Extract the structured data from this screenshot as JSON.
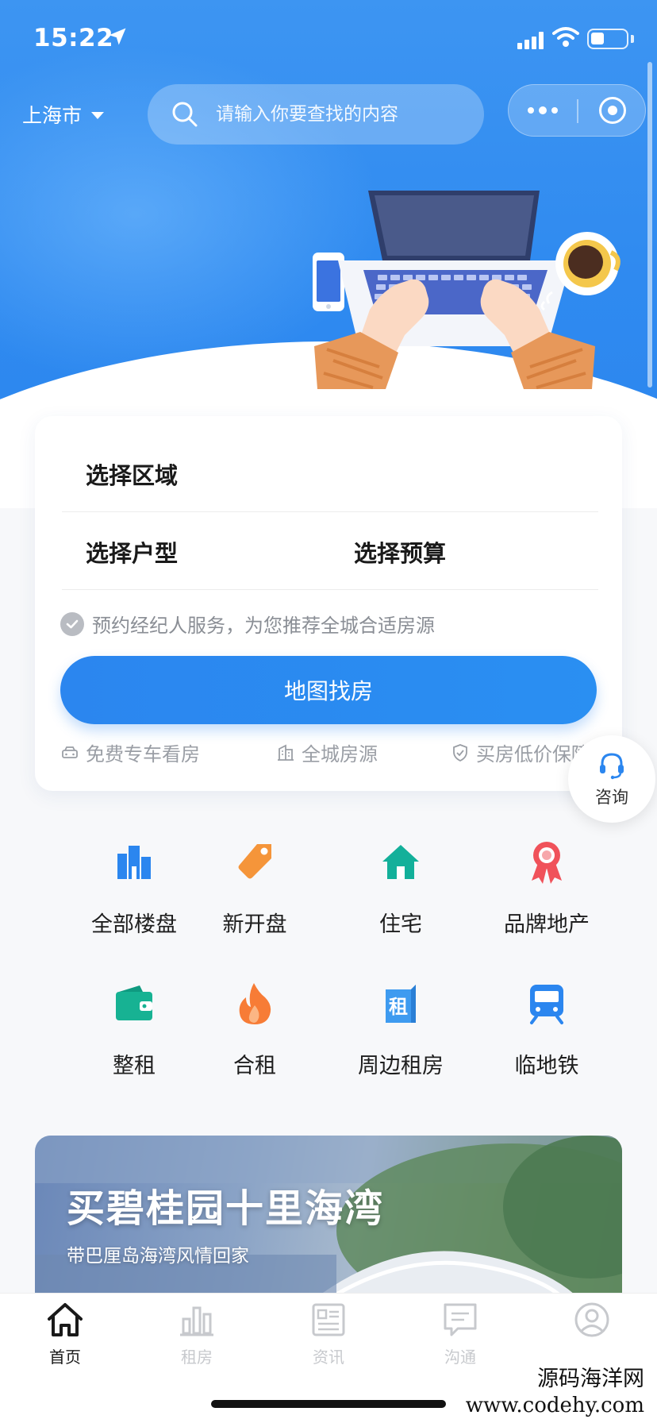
{
  "status_bar": {
    "time": "15:22"
  },
  "header": {
    "city": "上海市",
    "search_placeholder": "请输入你要查找的内容"
  },
  "search_card": {
    "select_region": "选择区域",
    "select_type": "选择户型",
    "select_budget": "选择预算",
    "agent_service": "预约经纪人服务，为您推荐全城合适房源",
    "map_button": "地图找房",
    "features": [
      "免费专车看房",
      "全城房源",
      "买房低价保障"
    ]
  },
  "consult": {
    "label": "咨询"
  },
  "categories": [
    {
      "label": "全部楼盘",
      "icon": "buildings-icon",
      "color": "#2b86ef"
    },
    {
      "label": "新开盘",
      "icon": "tag-icon",
      "color": "#f5953a"
    },
    {
      "label": "住宅",
      "icon": "house-icon",
      "color": "#13b09a"
    },
    {
      "label": "品牌地产",
      "icon": "award-ribbon-icon",
      "color": "#f0525a"
    },
    {
      "label": "整租",
      "icon": "wallet-icon",
      "color": "#17b293"
    },
    {
      "label": "合租",
      "icon": "flame-icon",
      "color": "#f77c36"
    },
    {
      "label": "周边租房",
      "icon": "rent-building-icon",
      "glyph": "租",
      "color": "#3e9bf0"
    },
    {
      "label": "临地铁",
      "icon": "subway-icon",
      "color": "#2b86ef"
    }
  ],
  "banner": {
    "title": "买碧桂园十里海湾",
    "subtitle": "带巴厘岛海湾风情回家"
  },
  "tabbar": {
    "tabs": [
      {
        "label": "首页",
        "icon": "home-icon",
        "active": true
      },
      {
        "label": "租房",
        "icon": "bar-chart-icon",
        "active": false
      },
      {
        "label": "资讯",
        "icon": "news-icon",
        "active": false
      },
      {
        "label": "沟通",
        "icon": "message-icon",
        "active": false
      },
      {
        "label": "",
        "icon": "user-icon",
        "active": false
      }
    ]
  },
  "watermark": {
    "line1": "源码海洋网",
    "line2": "www.codehy.com"
  },
  "colors": {
    "primary": "#2b86ef",
    "hero_bg": "#3d95f2"
  }
}
